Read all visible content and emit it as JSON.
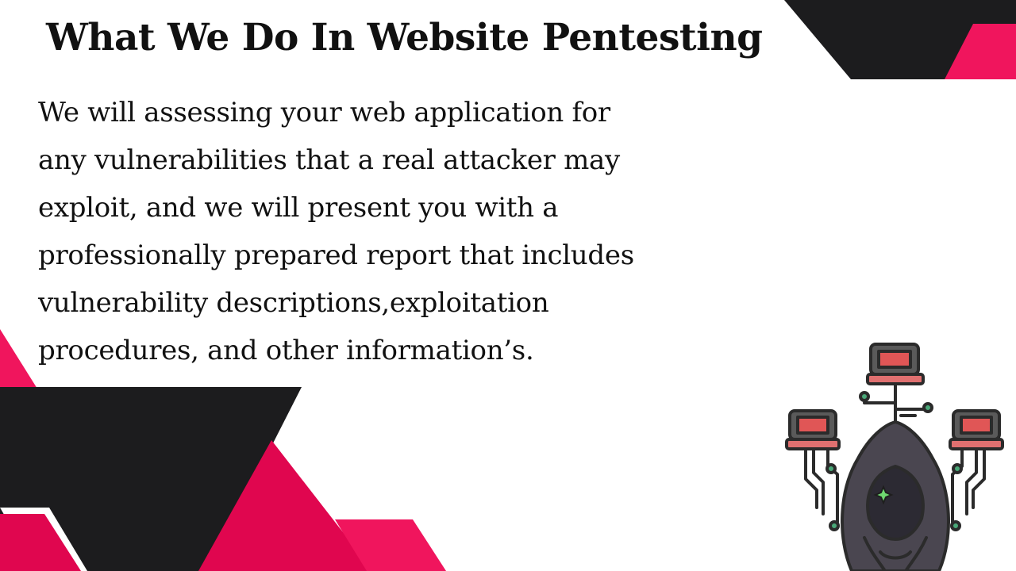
{
  "slide": {
    "title": "What We Do In Website Pentesting",
    "body_lines": [
      "We will assessing your web application for",
      "any vulnerabilities that a real attacker may",
      "exploit, and we will present you with a",
      "professionally prepared report that includes",
      "vulnerability descriptions,exploitation",
      "procedures, and other information’s."
    ]
  },
  "colors": {
    "background": "#ffffff",
    "text": "#111111",
    "accent_pink": "#f0155d",
    "dark": "#1c1c1e",
    "hood": "#4a4650",
    "screen_red": "#e05656",
    "glow_green": "#6fd870"
  },
  "illustration": {
    "icon": "hooded-hacker-with-network-icon"
  }
}
